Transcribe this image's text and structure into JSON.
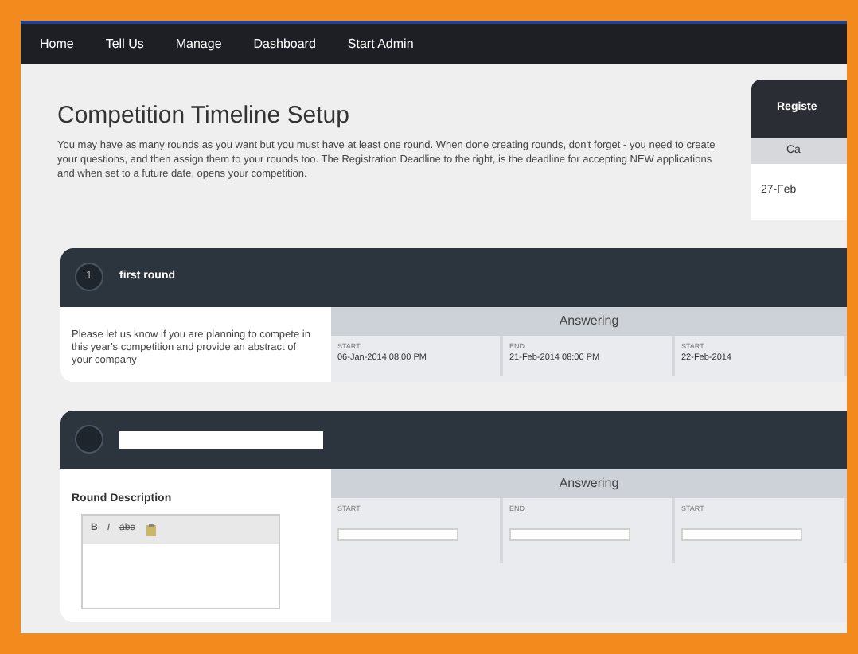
{
  "nav": {
    "items": [
      "Home",
      "Tell Us",
      "Manage",
      "Dashboard",
      "Start Admin"
    ]
  },
  "title": "Competition Timeline Setup",
  "intro": "You may have as many rounds as you want but you must have at least one round. When done creating rounds, don't forget - you need to create your questions, and then assign them to your rounds too. The Registration Deadline to the right, is the deadline for accepting NEW applications and when set to a future date, opens your competition.",
  "registration": {
    "title": "Registe",
    "column": "Ca",
    "value": "27-Feb"
  },
  "rounds": [
    {
      "kind": "saved",
      "number": "1",
      "name": "first round",
      "description": "Please let us know if you are planning to compete in this year's competition and provide an abstract of your company",
      "phase": "Answering",
      "fields": [
        {
          "label": "START",
          "value": "06-Jan-2014 08:00 PM"
        },
        {
          "label": "END",
          "value": "21-Feb-2014 08:00 PM"
        },
        {
          "label": "START",
          "value": "22-Feb-2014"
        }
      ]
    },
    {
      "kind": "new",
      "description_label": "Round Description",
      "toolbar": [
        "B",
        "I",
        "abc"
      ],
      "phase": "Answering",
      "fields": [
        {
          "label": "START"
        },
        {
          "label": "END"
        },
        {
          "label": "START"
        }
      ]
    }
  ]
}
